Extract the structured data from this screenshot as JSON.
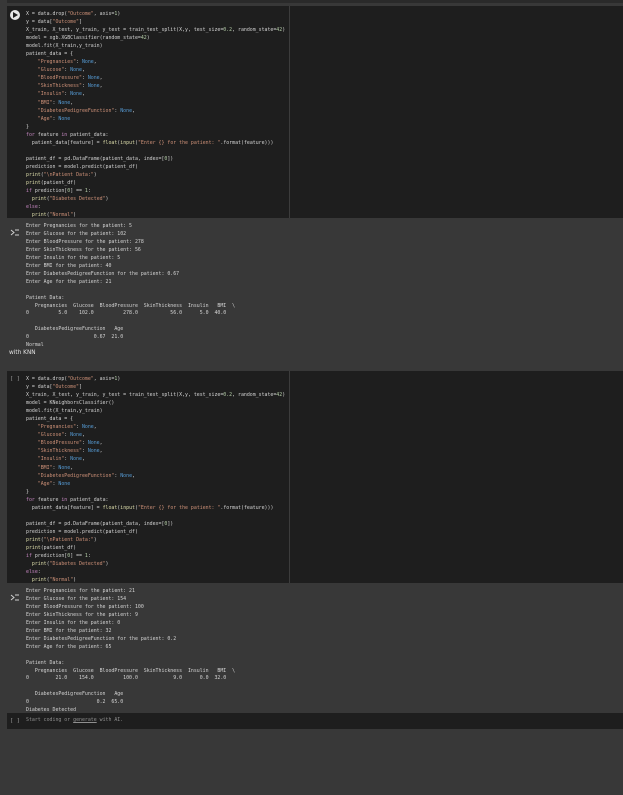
{
  "cell1": {
    "exec_count": "",
    "code": "X = data.drop(\"Outcome\", axis=1)\ny = data[\"Outcome\"]\nX_train, X_test, y_train, y_test = train_test_split(X,y, test_size=0.2, random_state=42)\nmodel = xgb.XGBClassifier(random_state=42)\nmodel.fit(X_train,y_train)\npatient_data = {\n    \"Pregnancies\": None,\n    \"Glucose\": None,\n    \"BloodPressure\": None,\n    \"SkinThickness\": None,\n    \"Insulin\": None,\n    \"BMI\": None,\n    \"DiabetesPedigreeFunction\": None,\n    \"Age\": None\n}\nfor feature in patient_data:\n  patient_data[feature] = float(input(\"Enter {} for the patient: \".format(feature)))\n\npatient_df = pd.DataFrame(patient_data, index=[0])\nprediction = model.predict(patient_df)\nprint(\"\\nPatient Data:\")\nprint(patient_df)\nif prediction[0] == 1:\n  print(\"Diabetes Detected\")\nelse:\n  print(\"Normal\")",
    "output": "Enter Pregnancies for the patient: 5\nEnter Glucose for the patient: 102\nEnter BloodPressure for the patient: 278\nEnter SkinThickness for the patient: 56\nEnter Insulin for the patient: 5\nEnter BMI for the patient: 40\nEnter DiabetesPedigreeFunction for the patient: 0.67\nEnter Age for the patient: 21\n\nPatient Data:\n   Pregnancies  Glucose  BloodPressure  SkinThickness  Insulin   BMI  \\\n0          5.0    102.0          278.0           56.0      5.0  40.0\n\n   DiabetesPedigreeFunction   Age\n0                      0.67  21.0\nNormal"
  },
  "markdown": {
    "text": "with KNN"
  },
  "cell2": {
    "exec_count": "[ ]",
    "code": "X = data.drop(\"Outcome\", axis=1)\ny = data[\"Outcome\"]\nX_train, X_test, y_train, y_test = train_test_split(X,y, test_size=0.2, random_state=42)\nmodel = KNeighborsClassifier()\nmodel.fit(X_train,y_train)\npatient_data = {\n    \"Pregnancies\": None,\n    \"Glucose\": None,\n    \"BloodPressure\": None,\n    \"SkinThickness\": None,\n    \"Insulin\": None,\n    \"BMI\": None,\n    \"DiabetesPedigreeFunction\": None,\n    \"Age\": None\n}\nfor feature in patient_data:\n  patient_data[feature] = float(input(\"Enter {} for the patient: \".format(feature)))\n\npatient_df = pd.DataFrame(patient_data, index=[0])\nprediction = model.predict(patient_df)\nprint(\"\\nPatient Data:\")\nprint(patient_df)\nif prediction[0] == 1:\n  print(\"Diabetes Detected\")\nelse:\n  print(\"Normal\")",
    "output": "Enter Pregnancies for the patient: 21\nEnter Glucose for the patient: 154\nEnter BloodPressure for the patient: 100\nEnter SkinThickness for the patient: 9\nEnter Insulin for the patient: 0\nEnter BMI for the patient: 32\nEnter DiabetesPedigreeFunction for the patient: 0.2\nEnter Age for the patient: 65\n\nPatient Data:\n   Pregnancies  Glucose  BloodPressure  SkinThickness  Insulin   BMI  \\\n0         21.0    154.0          100.0            9.0      0.0  32.0\n\n   DiabetesPedigreeFunction   Age\n0                       0.2  65.0\nDiabetes Detected"
  },
  "new_cell": {
    "exec_count": "[ ]",
    "placeholder_prefix": "Start coding or ",
    "generate_link": "generate",
    "placeholder_suffix": " with AI."
  },
  "colors": {
    "keyword": "#c586c0",
    "string": "#ce9178",
    "number": "#b5cea8",
    "builtin": "#dcdcaa",
    "text": "#d4d4d4",
    "control_kw": "#569cd6"
  }
}
